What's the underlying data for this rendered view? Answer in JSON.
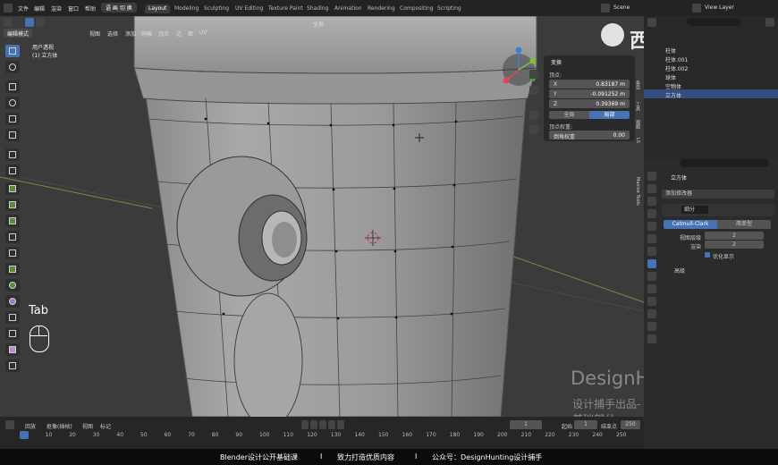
{
  "menubar": {
    "menus": [
      "文件",
      "编辑",
      "渲染",
      "窗口",
      "帮助"
    ],
    "mode_badge": "语 画 切 换",
    "workspace_tabs": [
      "Layout",
      "Modeling",
      "Sculpting",
      "UV Editing",
      "Texture Paint",
      "Shading",
      "Animation",
      "Rendering",
      "Compositing",
      "Scripting"
    ],
    "scene": "Scene",
    "view_layer": "View Layer"
  },
  "viewport_header": {
    "mode": "编辑模式",
    "menus": [
      "视图",
      "选择",
      "添加",
      "网格",
      "顶点",
      "边",
      "面",
      "UV"
    ],
    "orientation": "全局"
  },
  "viewport": {
    "view_name": "用户透视",
    "object_name": "(1) 立方体",
    "key_hint": "Tab"
  },
  "npanel": {
    "section": "变换",
    "vertex_label": "顶点:",
    "x_label": "X",
    "x_value": "0.83187 m",
    "y_label": "Y",
    "y_value": "-0.091252 m",
    "z_label": "Z",
    "z_value": "0.39369 m",
    "global_btn": "全局",
    "local_btn": "局部",
    "vertex_weight_label": "顶点权重:",
    "crease_label": "倒角权重",
    "crease_value": "0.00",
    "side_tabs": [
      "条目",
      "工具",
      "视图",
      "LS",
      "Maxive Tools"
    ]
  },
  "timeline": {
    "menus": [
      "回放",
      "抠像(插帧)",
      "视图",
      "标记"
    ],
    "current_frame": "1",
    "start_label": "起始",
    "start_value": "1",
    "end_label": "结束点",
    "end_value": "250",
    "ticks": [
      "0",
      "10",
      "20",
      "30",
      "40",
      "50",
      "60",
      "70",
      "80",
      "90",
      "100",
      "110",
      "120",
      "130",
      "140",
      "150",
      "160",
      "170",
      "180",
      "190",
      "200",
      "210",
      "220",
      "230",
      "240",
      "250"
    ]
  },
  "outliner": {
    "rows": [
      "柱体",
      "柱体.001",
      "柱体.002",
      "球体",
      "空物体",
      "立方体"
    ]
  },
  "properties": {
    "object_name": "立方体",
    "add_modifier": "添加修改器",
    "modifier_name": "细分",
    "catmull": "Catmull-Clark",
    "simple": "简单型",
    "viewport_levels_label": "视图层级",
    "viewport_levels_value": "2",
    "render_label": "渲染",
    "render_value": "2",
    "optimal_display": "优化显示",
    "advanced": "高级"
  },
  "watermark": {
    "brand": "西瓜视频",
    "line1": "DesignHunting",
    "line2": "设计捕手出品-基础部分"
  },
  "subtitle": {
    "left": "Blender设计公开基础课",
    "sep": "I",
    "middle": "致力打造优质内容",
    "right": "公众号：DesignHunting设计捕手"
  },
  "colors": {
    "accent": "#4772b3",
    "axis_x": "#e0455a",
    "axis_y": "#7cbf3b",
    "axis_z": "#3c7fd9",
    "selected_row": "#334d80"
  }
}
